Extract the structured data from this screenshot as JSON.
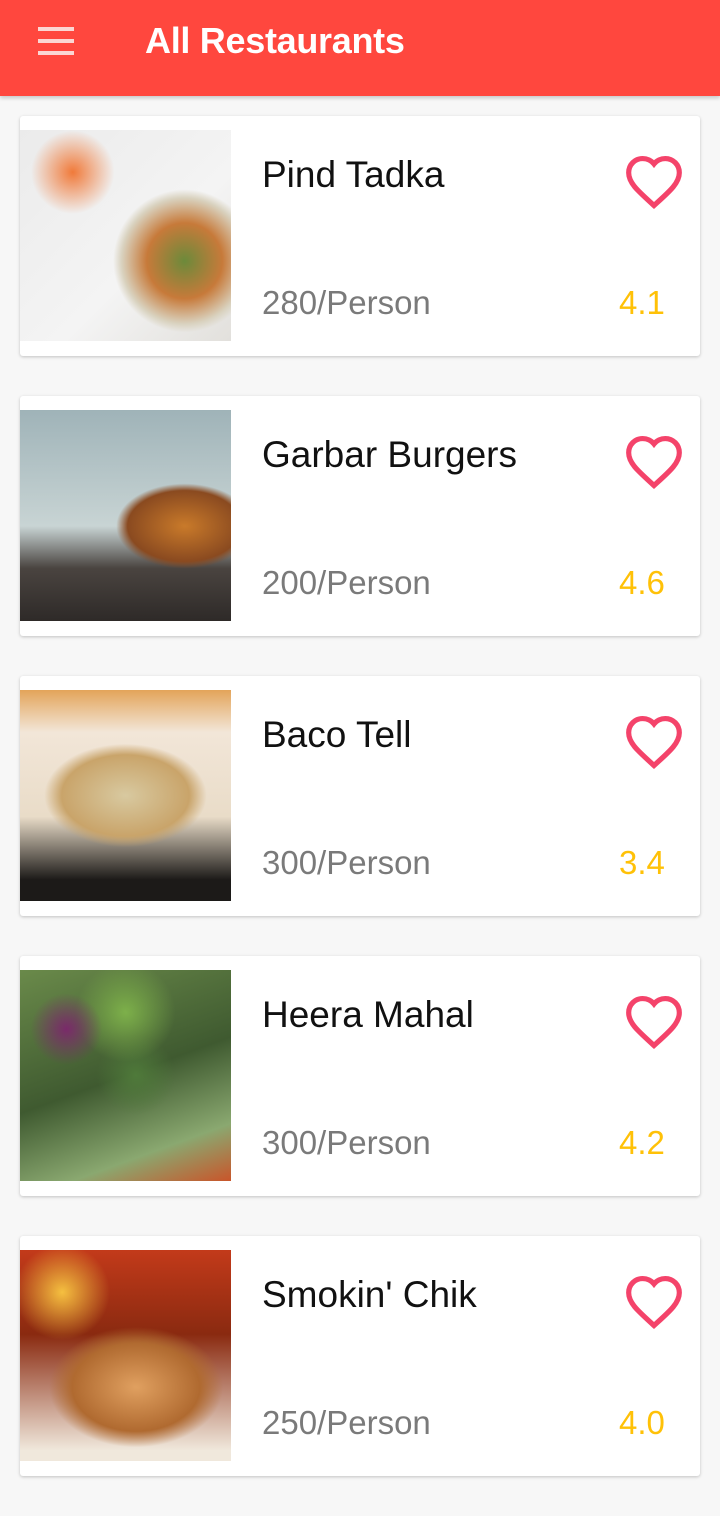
{
  "appbar": {
    "title": "All Restaurants",
    "menu_icon": "hamburger-menu-icon",
    "color": "#ff473e"
  },
  "restaurants": [
    {
      "name": "Pind Tadka",
      "price": "280/Person",
      "rating": "4.1",
      "image": "salad-bowl-photo",
      "favorite": false
    },
    {
      "name": "Garbar Burgers",
      "price": "200/Person",
      "rating": "4.6",
      "image": "burger-photo",
      "favorite": false
    },
    {
      "name": "Baco Tell",
      "price": "300/Person",
      "rating": "3.4",
      "image": "tacos-photo",
      "favorite": false
    },
    {
      "name": "Heera Mahal",
      "price": "300/Person",
      "rating": "4.2",
      "image": "vegetables-photo",
      "favorite": false
    },
    {
      "name": "Smokin' Chik",
      "price": "250/Person",
      "rating": "4.0",
      "image": "roast-chicken-photo",
      "favorite": false
    }
  ],
  "colors": {
    "heart": "#f4436a",
    "rating": "#ffc107",
    "price": "#7a7a7a"
  }
}
